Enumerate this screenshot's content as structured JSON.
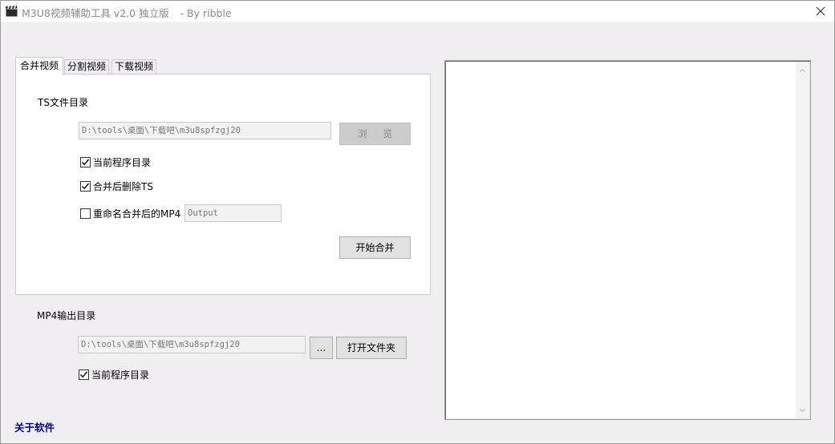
{
  "window": {
    "title": "M3U8视频辅助工具 v2.0 独立版",
    "author": "- By ribble"
  },
  "tabs": [
    {
      "label": "合并视频",
      "active": true
    },
    {
      "label": "分割视频",
      "active": false
    },
    {
      "label": "下载视频",
      "active": false
    }
  ],
  "merge": {
    "ts_dir_label": "TS文件目录",
    "ts_dir_value": "D:\\tools\\桌面\\下载吧\\m3u8spfzgj20",
    "browse_label": "浏 览",
    "current_dir_label": "当前程序目录",
    "current_dir_checked": true,
    "delete_ts_label": "合并后删除TS",
    "delete_ts_checked": true,
    "rename_label": "重命名合并后的MP4",
    "rename_checked": false,
    "rename_value": "Output",
    "start_label": "开始合并"
  },
  "output": {
    "dir_label": "MP4输出目录",
    "dir_value": "D:\\tools\\桌面\\下载吧\\m3u8spfzgj20",
    "dots_label": "...",
    "open_folder_label": "打开文件夹",
    "current_dir_label": "当前程序目录",
    "current_dir_checked": true
  },
  "about_label": "关于软件",
  "colors": {
    "background": "#f0eef1",
    "link": "#00008b",
    "disabled_button": "#cccccc"
  }
}
